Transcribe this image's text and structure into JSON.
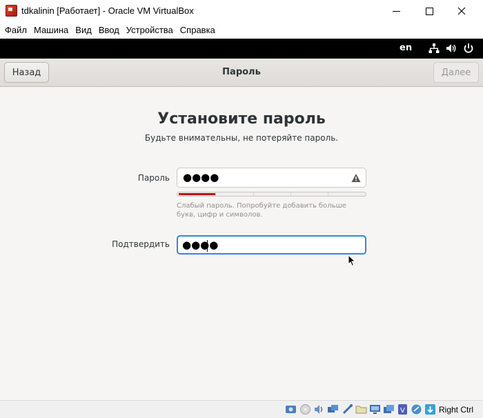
{
  "window": {
    "title": "tdkalinin [Работает] - Oracle VM VirtualBox"
  },
  "menu": [
    "Файл",
    "Машина",
    "Вид",
    "Ввод",
    "Устройства",
    "Справка"
  ],
  "guest_topbar": {
    "language": "en",
    "icons": [
      "network-icon",
      "volume-icon",
      "power-icon"
    ]
  },
  "headerbar": {
    "back_label": "Назад",
    "title": "Пароль",
    "next_label": "Далее"
  },
  "page": {
    "title": "Установите пароль",
    "subtitle": "Будьте внимательны, не потеряйте пароль."
  },
  "form": {
    "password_label": "Пароль",
    "password_value": "●●●●",
    "strength_level": 0.2,
    "strength_color": "#cc0000",
    "hint": "Слабый пароль. Попробуйте добавить больше букв, цифр и символов.",
    "confirm_label": "Подтвердить",
    "confirm_value": "●●●●"
  },
  "statusbar": {
    "host_key": "Right Ctrl",
    "icons": [
      "hard-disk-icon",
      "optical-disk-icon",
      "audio-icon",
      "network-adapter-icon",
      "usb-icon",
      "shared-folders-icon",
      "display-icon",
      "recording-icon",
      "vrde-icon",
      "cpu-icon",
      "mouse-integration-icon",
      "keyboard-capture-icon"
    ]
  },
  "colors": {
    "accent": "#3584e4",
    "weak": "#cc0000",
    "topbar": "#000000"
  }
}
